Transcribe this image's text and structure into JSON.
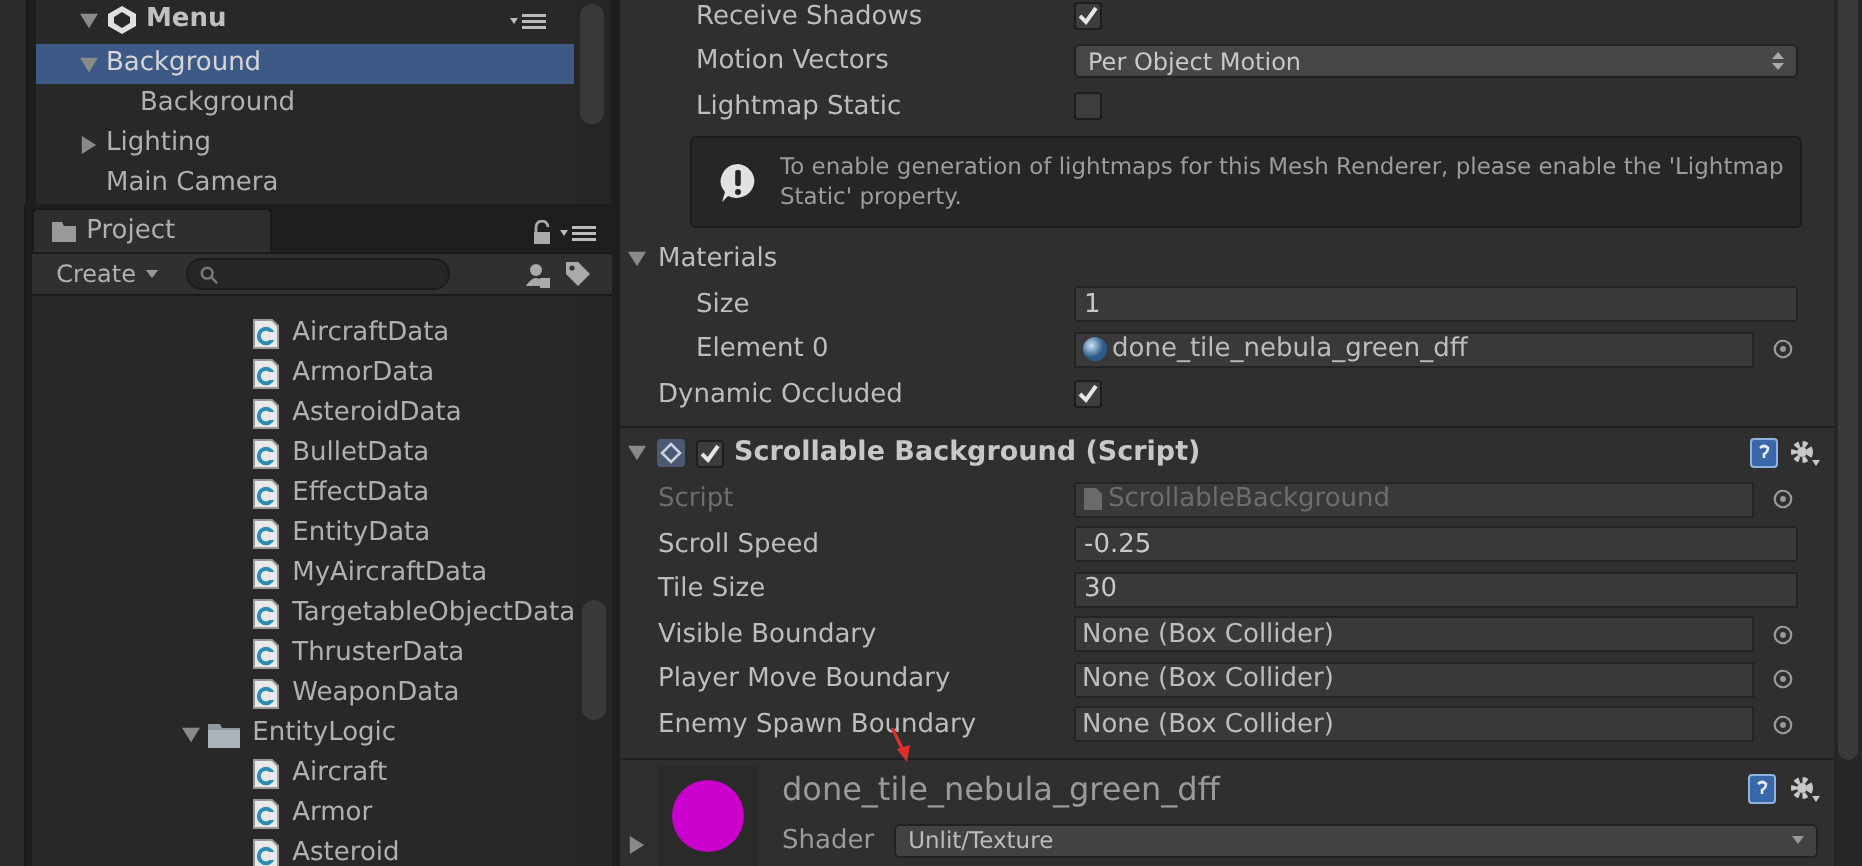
{
  "hierarchy": {
    "scene": "Menu",
    "items": [
      {
        "label": "Background",
        "kind": "group",
        "expanded": true,
        "selected": true,
        "children": [
          {
            "label": "Background",
            "kind": "leaf",
            "selected": false
          }
        ]
      },
      {
        "label": "Lighting",
        "kind": "group",
        "expanded": false,
        "selected": false
      },
      {
        "label": "Main Camera",
        "kind": "leaf",
        "selected": false
      }
    ]
  },
  "project": {
    "tab": "Project",
    "create": "Create",
    "items": [
      {
        "kind": "group",
        "children": [
          {
            "kind": "script",
            "label": "AircraftData"
          },
          {
            "kind": "script",
            "label": "ArmorData"
          },
          {
            "kind": "script",
            "label": "AsteroidData"
          },
          {
            "kind": "script",
            "label": "BulletData"
          },
          {
            "kind": "script",
            "label": "EffectData"
          },
          {
            "kind": "script",
            "label": "EntityData"
          },
          {
            "kind": "script",
            "label": "MyAircraftData"
          },
          {
            "kind": "script",
            "label": "TargetableObjectData"
          },
          {
            "kind": "script",
            "label": "ThrusterData"
          },
          {
            "kind": "script",
            "label": "WeaponData"
          }
        ]
      },
      {
        "kind": "folder",
        "label": "EntityLogic",
        "expanded": true,
        "children": [
          {
            "kind": "script",
            "label": "Aircraft"
          },
          {
            "kind": "script",
            "label": "Armor"
          },
          {
            "kind": "script",
            "label": "Asteroid"
          }
        ]
      }
    ]
  },
  "inspector": {
    "sections": [
      {
        "kind": "plain",
        "rows": [
          {
            "kind": "group",
            "children": [
              {
                "kind": "checkbox",
                "label": "Receive Shadows",
                "checked": true
              },
              {
                "kind": "dropdown",
                "label": "Motion Vectors",
                "value": "Per Object Motion"
              },
              {
                "kind": "checkbox",
                "label": "Lightmap Static",
                "checked": false
              },
              {
                "kind": "help",
                "text": "To enable generation of lightmaps for this Mesh Renderer, please enable the 'Lightmap Static' property."
              }
            ]
          },
          {
            "kind": "foldout",
            "label": "Materials",
            "expanded": true,
            "children": [
              {
                "kind": "text",
                "label": "Size",
                "value": "1"
              },
              {
                "kind": "asset",
                "label": "Element 0",
                "value": "done_tile_nebula_green_dff"
              }
            ]
          },
          {
            "kind": "checkbox",
            "label": "Dynamic Occluded",
            "checked": true
          }
        ]
      },
      {
        "kind": "component",
        "title": "Scrollable Background (Script)",
        "enabled": true,
        "expanded": true,
        "rows": [
          {
            "kind": "script_ref",
            "label": "Script",
            "value": "ScrollableBackground",
            "disabled": true
          },
          {
            "kind": "text",
            "label": "Scroll Speed",
            "value": "-0.25",
            "disabled": false
          },
          {
            "kind": "text",
            "label": "Tile Size",
            "value": "30",
            "disabled": false
          },
          {
            "kind": "object",
            "label": "Visible Boundary",
            "value": "None (Box Collider)",
            "disabled": false
          },
          {
            "kind": "object",
            "label": "Player Move Boundary",
            "value": "None (Box Collider)",
            "disabled": false
          },
          {
            "kind": "object",
            "label": "Enemy Spawn Boundary",
            "value": "None (Box Collider)",
            "disabled": false
          }
        ]
      },
      {
        "kind": "material",
        "name": "done_tile_nebula_green_dff",
        "shader_label": "Shader",
        "shader": "Unlit/Texture",
        "expanded": false
      }
    ]
  }
}
